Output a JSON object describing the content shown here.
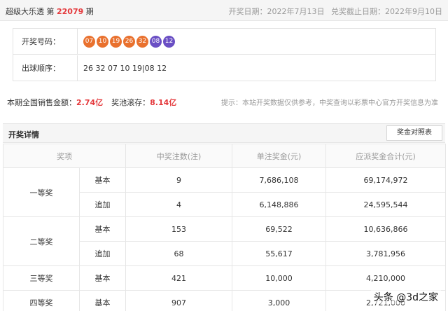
{
  "header": {
    "title_prefix": "超级大乐透 第",
    "issue": "22079",
    "title_suffix": "期",
    "draw_date": "开奖日期：2022年7月13日",
    "deadline": "兑奖截止日期：2022年9月10日"
  },
  "info": {
    "numbers_label": "开奖号码：",
    "front_balls": [
      "07",
      "10",
      "19",
      "26",
      "32"
    ],
    "back_balls": [
      "08",
      "12"
    ],
    "order_label": "出球顺序：",
    "order_value": "26 32 07 10 19|08 12"
  },
  "sales": {
    "sales_label": "本期全国销售金额：",
    "sales_value": "2.74亿",
    "pool_label": "奖池滚存：",
    "pool_value": "8.14亿",
    "notice": "提示：本站开奖数据仅供参考，中奖查询以彩票中心官方开奖信息为准"
  },
  "detail": {
    "title": "开奖详情",
    "compare_button": "奖金对照表",
    "headers": [
      "奖项",
      "中奖注数(注)",
      "单注奖金(元)",
      "应派奖金合计(元)"
    ],
    "rows": [
      {
        "level": "一等奖",
        "type": "基本",
        "count": "9",
        "prize": "7,686,108",
        "total": "69,174,972"
      },
      {
        "level": "",
        "type": "追加",
        "count": "4",
        "prize": "6,148,886",
        "total": "24,595,544"
      },
      {
        "level": "二等奖",
        "type": "基本",
        "count": "153",
        "prize": "69,522",
        "total": "10,636,866"
      },
      {
        "level": "",
        "type": "追加",
        "count": "68",
        "prize": "55,617",
        "total": "3,781,956"
      },
      {
        "level": "三等奖",
        "type": "基本",
        "count": "421",
        "prize": "10,000",
        "total": "4,210,000"
      },
      {
        "level": "四等奖",
        "type": "基本",
        "count": "907",
        "prize": "3,000",
        "total": "2,721,000"
      }
    ]
  },
  "watermark": "头条 @3d之家",
  "colors": {
    "red_ball": "#e9712e",
    "blue_ball": "#6a4fc4",
    "highlight": "#e4393c"
  }
}
